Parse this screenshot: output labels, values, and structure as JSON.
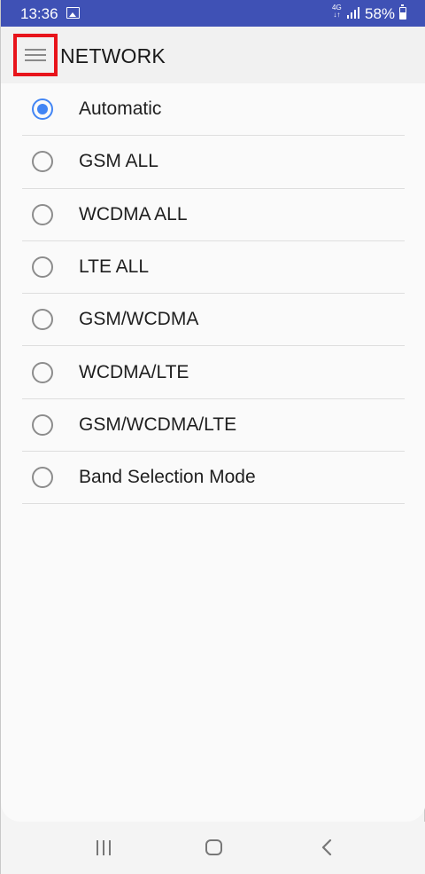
{
  "status_bar": {
    "time": "13:36",
    "network_type_top": "4G",
    "network_type_bottom": "↓↑",
    "battery_percent": "58%"
  },
  "header": {
    "title": "NETWORK",
    "menu_icon": "hamburger-menu-icon"
  },
  "options": [
    {
      "label": "Automatic",
      "checked": true
    },
    {
      "label": "GSM ALL",
      "checked": false
    },
    {
      "label": "WCDMA ALL",
      "checked": false
    },
    {
      "label": "LTE ALL",
      "checked": false
    },
    {
      "label": "GSM/WCDMA",
      "checked": false
    },
    {
      "label": "WCDMA/LTE",
      "checked": false
    },
    {
      "label": "GSM/WCDMA/LTE",
      "checked": false
    },
    {
      "label": "Band Selection Mode",
      "checked": false
    }
  ],
  "colors": {
    "status_bar": "#3f51b5",
    "radio_selected": "#4285f4",
    "highlight_box": "#e8141b"
  },
  "nav_bar": {
    "icons": [
      "recents-icon",
      "home-icon",
      "back-icon"
    ]
  }
}
